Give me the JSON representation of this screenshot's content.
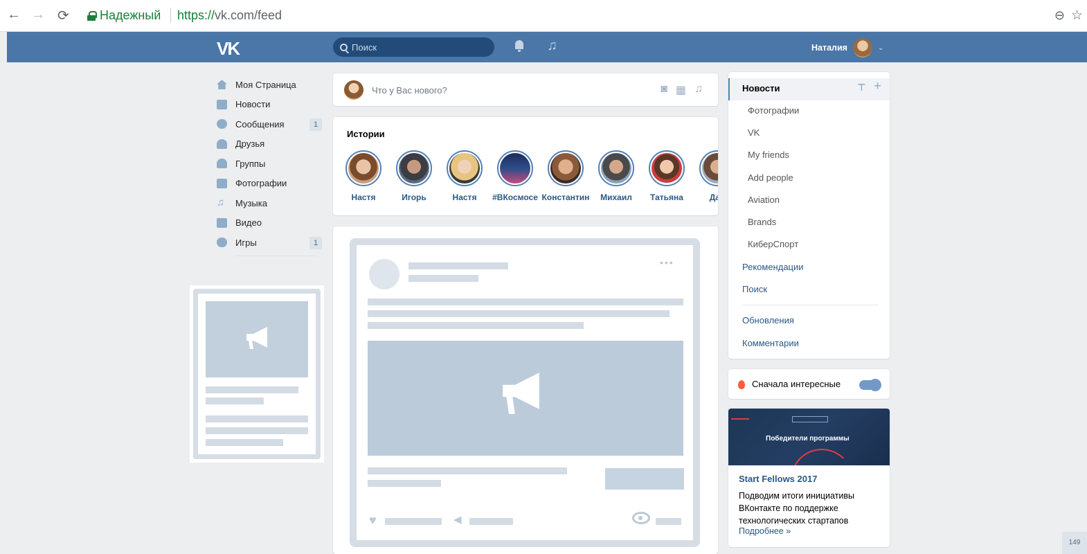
{
  "browser": {
    "secure_label": "Надежный",
    "url_scheme": "https://",
    "url_rest": "vk.com/feed"
  },
  "header": {
    "logo": "VK",
    "search_placeholder": "Поиск",
    "user_name": "Наталия"
  },
  "left_menu": [
    {
      "label": "Моя Страница",
      "icon": "home-icon"
    },
    {
      "label": "Новости",
      "icon": "news-icon"
    },
    {
      "label": "Сообщения",
      "icon": "messages-icon",
      "badge": "1"
    },
    {
      "label": "Друзья",
      "icon": "friends-icon"
    },
    {
      "label": "Группы",
      "icon": "groups-icon"
    },
    {
      "label": "Фотографии",
      "icon": "camera-icon"
    },
    {
      "label": "Музыка",
      "icon": "music-icon"
    },
    {
      "label": "Видео",
      "icon": "video-icon"
    },
    {
      "label": "Игры",
      "icon": "games-icon",
      "badge": "1"
    }
  ],
  "post_box": {
    "prompt": "Что у Вас нового?"
  },
  "stories": {
    "title": "Истории",
    "items": [
      "Настя",
      "Игорь",
      "Настя",
      "#ВКосмосе",
      "Константин",
      "Михаил",
      "Татьяна",
      "Дан"
    ]
  },
  "right_menu": {
    "selected": "Новости",
    "sub_items": [
      "Фотографии",
      "VK",
      "My friends",
      "Add people",
      "Aviation",
      "Brands",
      "КиберСпорт"
    ],
    "items": [
      "Рекомендации",
      "Поиск"
    ],
    "items2": [
      "Обновления",
      "Комментарии"
    ]
  },
  "interesting_toggle": {
    "label": "Сначала интересные",
    "on": true
  },
  "promo": {
    "banner_title": "Победители программы",
    "title": "Start Fellows 2017",
    "text": "Подводим итоги инициативы ВКонтакте по поддержке технологических стартапов",
    "link": "Подробнее »"
  },
  "page_counter": "149",
  "colors": {
    "header": "#4a76a8",
    "link": "#2a5885",
    "background": "#edeef0"
  }
}
